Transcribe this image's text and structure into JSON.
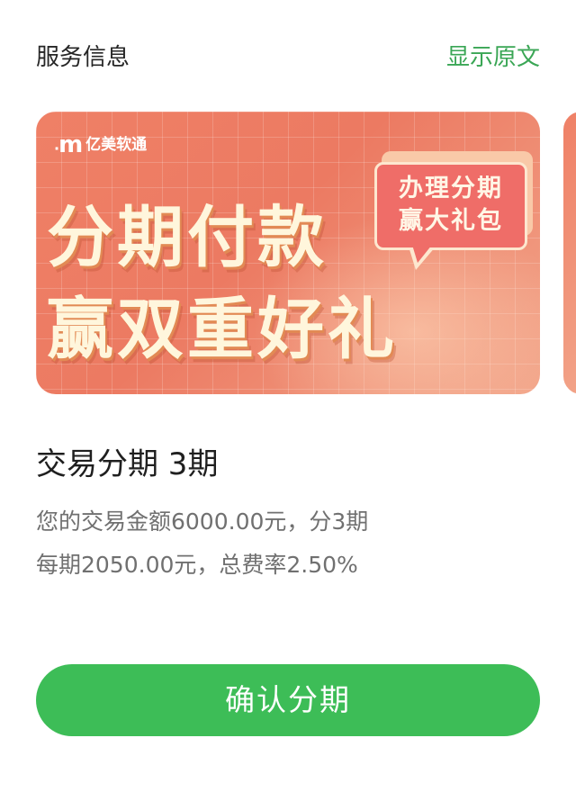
{
  "header": {
    "title": "服务信息",
    "show_original_link": "显示原文"
  },
  "banner": {
    "brand_name": "亿美软通",
    "brand_subtitle": "",
    "headline_line1": "分期付款",
    "headline_line2": "赢双重好礼",
    "bubble_line1": "办理分期",
    "bubble_line2": "赢大礼包"
  },
  "details": {
    "title": "交易分期 3期",
    "line1": "您的交易金额6000.00元，分3期",
    "line2": "每期2050.00元，总费率2.50%"
  },
  "actions": {
    "confirm_label": "确认分期"
  },
  "colors": {
    "accent_green": "#3dbd57",
    "link_green": "#3aa655",
    "banner_coral": "#ef8066"
  }
}
